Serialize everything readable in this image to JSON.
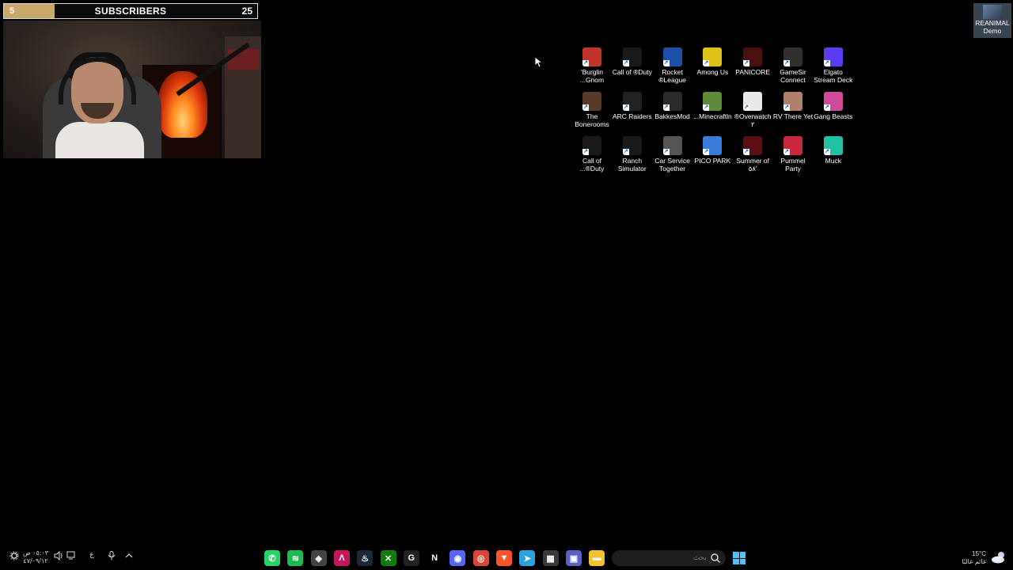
{
  "overlay": {
    "subscribers": {
      "current": "5",
      "title": "SUBSCRIBERS",
      "goal": "25",
      "progress_fraction": 0.2
    }
  },
  "desktop": {
    "icons": [
      {
        "label": "'Burglin ...Gnom",
        "icon": "burglin-gnomes-icon",
        "color": "#c0342a"
      },
      {
        "label": "Call of ®Duty",
        "icon": "call-of-duty-icon",
        "color": "#1a1a1a"
      },
      {
        "label": "Rocket ®League",
        "icon": "rocket-league-icon",
        "color": "#1f4fa8"
      },
      {
        "label": "Among Us",
        "icon": "among-us-icon",
        "color": "#e0c21a"
      },
      {
        "label": "PANICORE",
        "icon": "panicore-icon",
        "color": "#4a1010"
      },
      {
        "label": "GameSir Connect",
        "icon": "gamesir-icon",
        "color": "#303030"
      },
      {
        "label": "Elgato Stream Deck",
        "icon": "stream-deck-icon",
        "color": "#5b3cf0"
      },
      {
        "label": "The Bonerooms",
        "icon": "bonerooms-icon",
        "color": "#5a3a2a"
      },
      {
        "label": "ARC Raiders",
        "icon": "arc-raiders-icon",
        "color": "#222"
      },
      {
        "label": "BakkesMod",
        "icon": "bakkesmod-icon",
        "color": "#2a2a2a"
      },
      {
        "label": "...Minecraftln",
        "icon": "minecraft-icon",
        "color": "#5b8a3a"
      },
      {
        "label": "®Overwatch ٢",
        "icon": "overwatch-icon",
        "color": "#e8e8e8"
      },
      {
        "label": "RV There Yet",
        "icon": "rv-there-yet-icon",
        "color": "#b0806a"
      },
      {
        "label": "Gang Beasts",
        "icon": "gang-beasts-icon",
        "color": "#d04a9a"
      },
      {
        "label": "Call of ...®Duty",
        "icon": "call-of-duty-icon",
        "color": "#1a1a1a"
      },
      {
        "label": "Ranch Simulator",
        "icon": "ranch-simulator-icon",
        "color": "#1a1a1a"
      },
      {
        "label": "Car Service Together",
        "icon": "car-service-icon",
        "color": "#555"
      },
      {
        "label": "PICO PARK",
        "icon": "pico-park-icon",
        "color": "#3a7ad8"
      },
      {
        "label": "Summer of ٥٨'",
        "icon": "summer-58-icon",
        "color": "#5a1010"
      },
      {
        "label": "Pummel Party",
        "icon": "pummel-party-icon",
        "color": "#c8283a"
      },
      {
        "label": "Muck",
        "icon": "muck-icon",
        "color": "#20c0a0"
      }
    ],
    "corner_icon": {
      "label_line1": "REANIMAL",
      "label_line2": "Demo",
      "icon": "reanimal-demo-icon"
    }
  },
  "taskbar": {
    "search_placeholder": "بحث",
    "tray": {
      "time": "٠٥:٠٣ ص",
      "date": "٤٧/٠٩/١٢",
      "language": "ع"
    },
    "weather": {
      "temp": "15°C",
      "condition": "غائم غالبًا"
    },
    "apps": [
      {
        "name": "whatsapp-icon",
        "glyph": "✆",
        "color": "#25d366"
      },
      {
        "name": "spotify-icon",
        "glyph": "≋",
        "color": "#1db954"
      },
      {
        "name": "unity-icon",
        "glyph": "◈",
        "color": "#444"
      },
      {
        "name": "affinity-icon",
        "glyph": "Λ",
        "color": "#c2185b"
      },
      {
        "name": "steam-icon",
        "glyph": "♨",
        "color": "#1b2838"
      },
      {
        "name": "xbox-icon",
        "glyph": "✕",
        "color": "#107c10"
      },
      {
        "name": "ghub-icon",
        "glyph": "G",
        "color": "#222"
      },
      {
        "name": "netflix-icon",
        "glyph": "N",
        "color": "#000"
      },
      {
        "name": "discord-icon",
        "glyph": "◉",
        "color": "#5865f2"
      },
      {
        "name": "chrome-icon",
        "glyph": "◎",
        "color": "#db4437"
      },
      {
        "name": "brave-icon",
        "glyph": "▼",
        "color": "#fb542b"
      },
      {
        "name": "telegram-icon",
        "glyph": "➤",
        "color": "#2aa3e0"
      },
      {
        "name": "store-icon",
        "glyph": "▦",
        "color": "#3a3a3a"
      },
      {
        "name": "teams-icon",
        "glyph": "▣",
        "color": "#5b5fc7"
      },
      {
        "name": "file-explorer-icon",
        "glyph": "▬",
        "color": "#f2c12e"
      }
    ]
  }
}
